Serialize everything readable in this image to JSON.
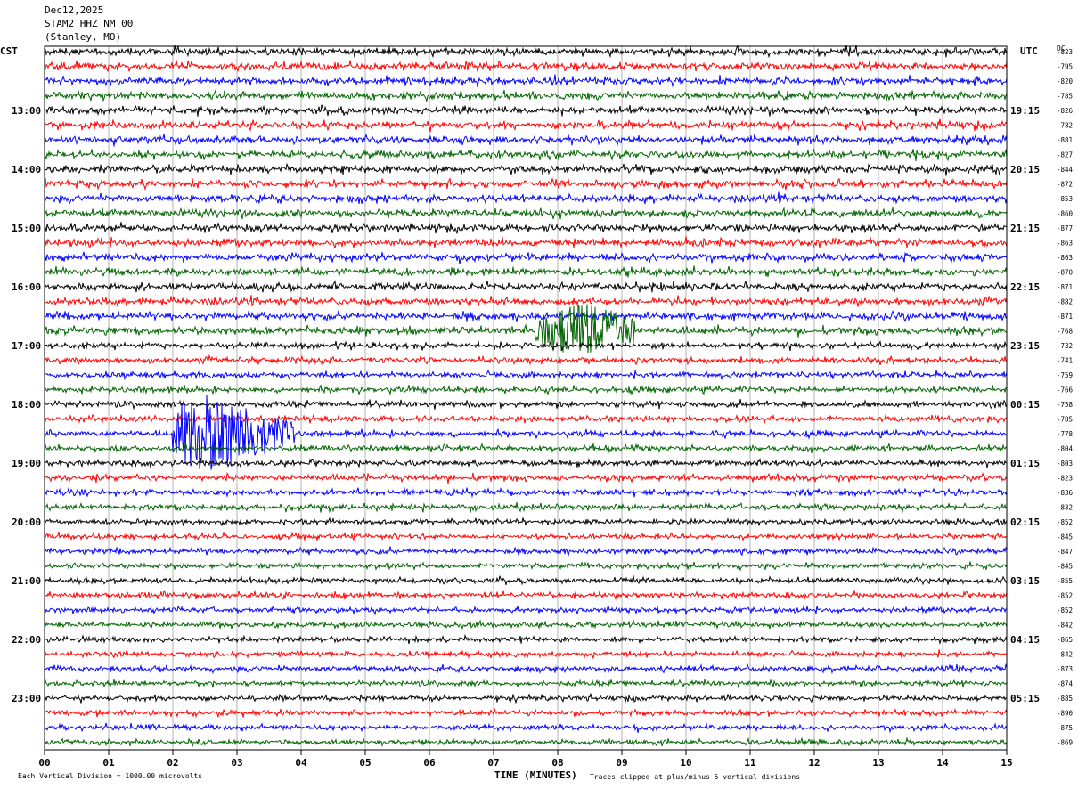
{
  "header": {
    "date": "Dec12,2025",
    "station": "STAM2 HHZ NM 00",
    "location": "(Stanley, MO)"
  },
  "left_tz": "CST",
  "right_tz": "UTC",
  "dc_label": "DC",
  "footer": {
    "scale_note": "Each Vertical Division = 1000.00 microvolts",
    "clip_note": "Traces clipped at plus/minus 5 vertical divisions",
    "xlabel": "TIME (MINUTES)"
  },
  "colors": [
    "#000000",
    "#ff0000",
    "#0000ff",
    "#006400"
  ],
  "chart_data": {
    "type": "line",
    "title": "Dec12,2025 STAM2 HHZ NM 00 (Stanley, MO)",
    "xlabel": "TIME (MINUTES)",
    "ylabel": "",
    "xlim": [
      0,
      15
    ],
    "x_ticks": [
      "00",
      "01",
      "02",
      "03",
      "04",
      "05",
      "06",
      "07",
      "08",
      "09",
      "10",
      "11",
      "12",
      "13",
      "14",
      "15"
    ],
    "left_time_labels": [
      "13:00",
      "14:00",
      "15:00",
      "16:00",
      "17:00",
      "18:00",
      "19:00",
      "20:00",
      "21:00",
      "22:00",
      "23:00"
    ],
    "right_time_labels": [
      "19:15",
      "20:15",
      "21:15",
      "22:15",
      "23:15",
      "00:15",
      "01:15",
      "02:15",
      "03:15",
      "04:15",
      "05:15"
    ],
    "dc_offsets": [
      -823,
      -795,
      -820,
      -785,
      -826,
      -782,
      -881,
      -827,
      -844,
      -872,
      -853,
      -860,
      -877,
      -863,
      -863,
      -870,
      -871,
      -882,
      -871,
      -768,
      -732,
      -741,
      -759,
      -766,
      -758,
      -785,
      -778,
      -804,
      -803,
      -823,
      -836,
      -832,
      -852,
      -845,
      -847,
      -845,
      -855,
      -852,
      -852,
      -842,
      -865,
      -842,
      -873,
      -874,
      -885,
      -890,
      -875,
      -869
    ],
    "trace_count": 48,
    "events": [
      {
        "trace": 19,
        "start_min": 7.6,
        "peak_min": 8.4,
        "end_min": 9.2,
        "amplitude": 3.5
      },
      {
        "trace": 26,
        "start_min": 2.0,
        "peak_min": 2.5,
        "end_min": 3.9,
        "amplitude": 5.0
      }
    ],
    "grid": true
  }
}
